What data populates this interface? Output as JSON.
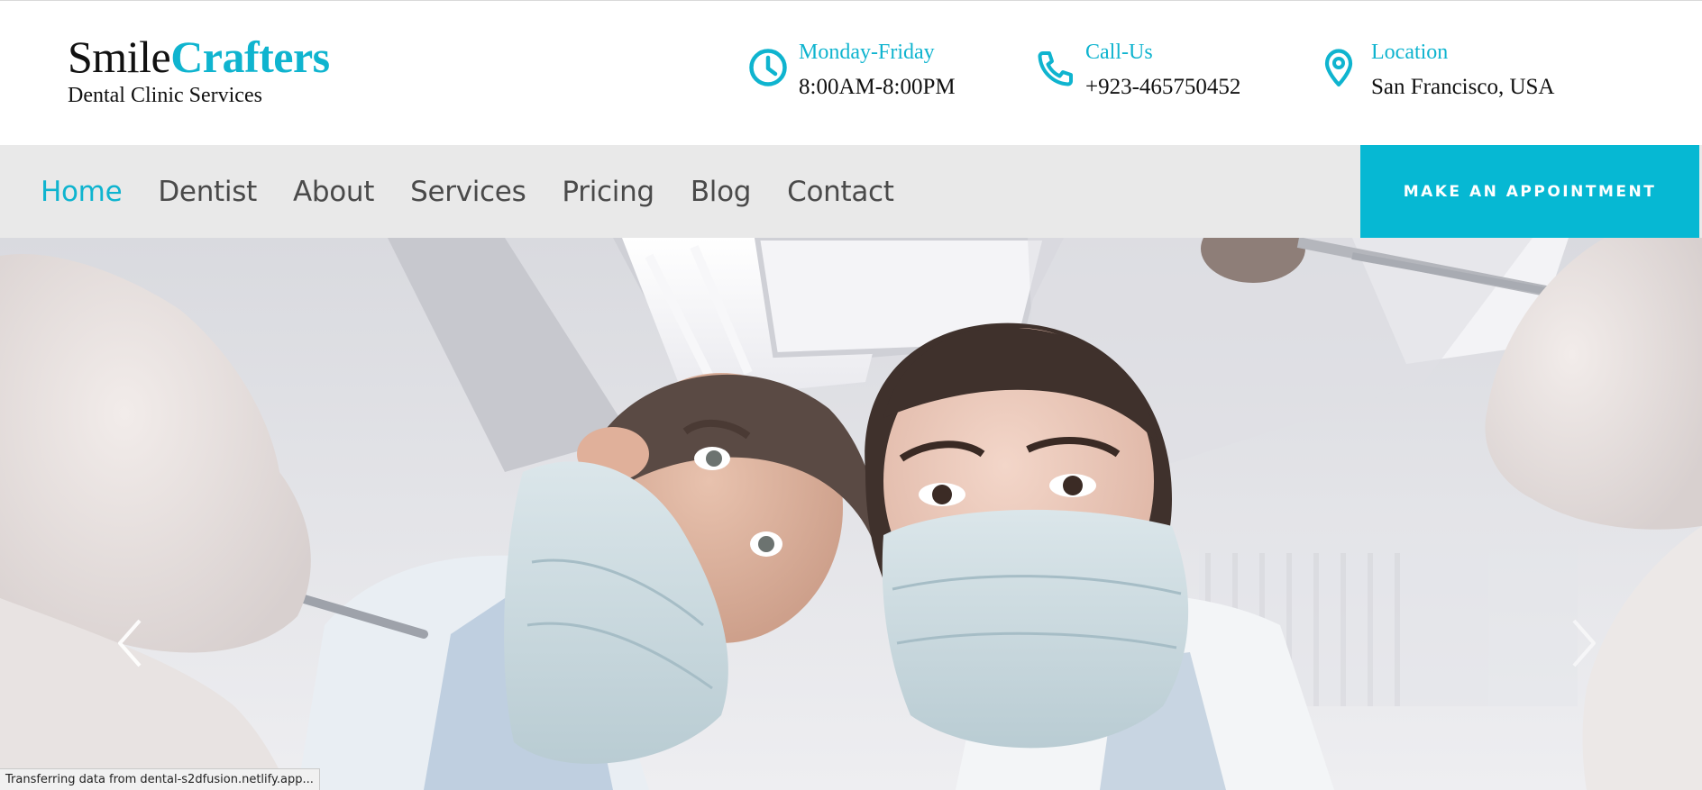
{
  "brand": {
    "name_part1": "Smile",
    "name_part2": "Crafters",
    "tagline": "Dental Clinic Services"
  },
  "header_info": [
    {
      "icon": "clock-icon",
      "label": "Monday-Friday",
      "value": "8:00AM-8:00PM"
    },
    {
      "icon": "phone-icon",
      "label": "Call-Us",
      "value": "+923-465750452"
    },
    {
      "icon": "location-pin-icon",
      "label": "Location",
      "value": "San Francisco, USA"
    }
  ],
  "nav": {
    "items": [
      {
        "label": "Home",
        "active": true
      },
      {
        "label": "Dentist",
        "active": false
      },
      {
        "label": "About",
        "active": false
      },
      {
        "label": "Services",
        "active": false
      },
      {
        "label": "Pricing",
        "active": false
      },
      {
        "label": "Blog",
        "active": false
      },
      {
        "label": "Contact",
        "active": false
      }
    ],
    "cta_label": "MAKE AN APPOINTMENT"
  },
  "hero": {
    "image": "two-dentists-with-masks-photo",
    "prev_icon": "chevron-left-icon",
    "next_icon": "chevron-right-icon"
  },
  "status_bar": {
    "text": "Transferring data from dental-s2dfusion.netlify.app..."
  },
  "colors": {
    "accent": "#0fb4cf",
    "cta_background": "#06b8d3",
    "nav_background": "#e9e9e9",
    "nav_text": "#4a4a4a"
  }
}
